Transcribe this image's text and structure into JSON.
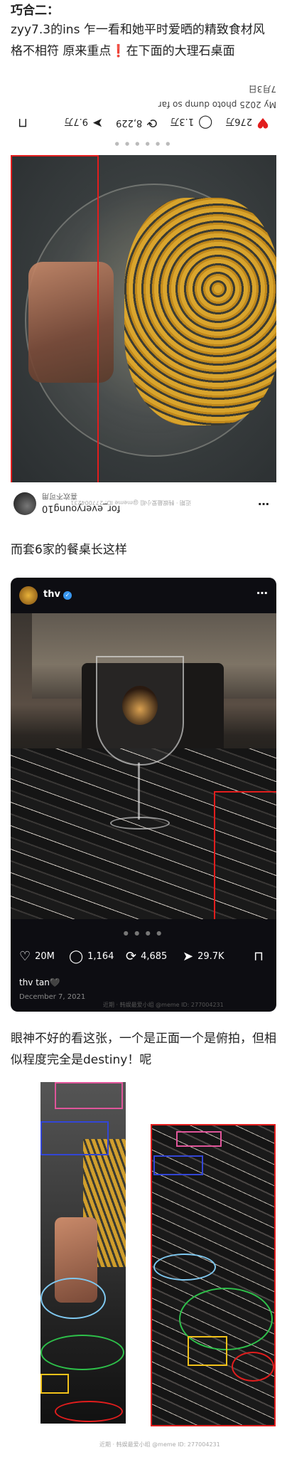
{
  "text": {
    "heading": "巧合二：",
    "intro": "zyy7.3的ins  乍一看和她平时爱晒的精致食材风格不相符  原来重点❗在下面的大理石桌面",
    "set_intro": "而套6家的餐桌长这样",
    "conclusion": "眼神不好的看这张，一个是正面一个是俯拍，但相似程度完全是destiny！呢"
  },
  "post1": {
    "caption": "My 2025 photo dump so far",
    "date": "7月3日",
    "likes": "276万",
    "comments": "1.3万",
    "reposts": "8,229",
    "shares": "9.7万",
    "username": "for_everyoung10",
    "location": "喜欢不可用",
    "watermark": "近期 · 韩娱最爱小组 @meme  ID: 277004231"
  },
  "post2": {
    "username": "thv",
    "likes": "20M",
    "comments": "1,164",
    "reposts": "4,685",
    "shares": "29.7K",
    "caption": "thv tan🖤",
    "date": "December 7, 2021",
    "watermark": "近期 · 韩娱最爱小组 @meme  ID: 277004231"
  },
  "comparison": {
    "watermark": "近期 · 韩娱最爱小组 @meme  ID: 277004231"
  },
  "colors": {
    "highlight_red": "#e21d1d",
    "pink": "#e0559a",
    "blue": "#3346d6",
    "light_blue": "#7fc8f0",
    "green": "#2ec04a",
    "yellow": "#f2c21a",
    "verified_blue": "#3897f0"
  },
  "icons": {
    "heart": "heart-icon",
    "comment": "comment-icon",
    "repost": "repost-icon",
    "share": "share-icon",
    "bookmark": "bookmark-icon",
    "more": "more-icon"
  }
}
